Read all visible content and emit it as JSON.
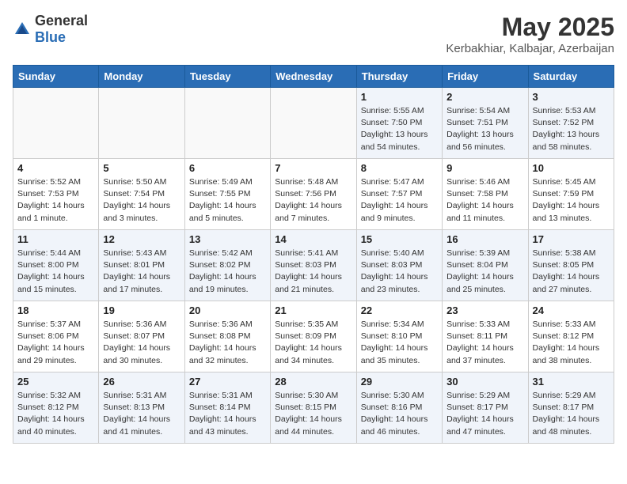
{
  "header": {
    "logo_general": "General",
    "logo_blue": "Blue",
    "month_year": "May 2025",
    "location": "Kerbakhiar, Kalbajar, Azerbaijan"
  },
  "days_of_week": [
    "Sunday",
    "Monday",
    "Tuesday",
    "Wednesday",
    "Thursday",
    "Friday",
    "Saturday"
  ],
  "weeks": [
    [
      {
        "day": "",
        "info": ""
      },
      {
        "day": "",
        "info": ""
      },
      {
        "day": "",
        "info": ""
      },
      {
        "day": "",
        "info": ""
      },
      {
        "day": "1",
        "info": "Sunrise: 5:55 AM\nSunset: 7:50 PM\nDaylight: 13 hours\nand 54 minutes."
      },
      {
        "day": "2",
        "info": "Sunrise: 5:54 AM\nSunset: 7:51 PM\nDaylight: 13 hours\nand 56 minutes."
      },
      {
        "day": "3",
        "info": "Sunrise: 5:53 AM\nSunset: 7:52 PM\nDaylight: 13 hours\nand 58 minutes."
      }
    ],
    [
      {
        "day": "4",
        "info": "Sunrise: 5:52 AM\nSunset: 7:53 PM\nDaylight: 14 hours\nand 1 minute."
      },
      {
        "day": "5",
        "info": "Sunrise: 5:50 AM\nSunset: 7:54 PM\nDaylight: 14 hours\nand 3 minutes."
      },
      {
        "day": "6",
        "info": "Sunrise: 5:49 AM\nSunset: 7:55 PM\nDaylight: 14 hours\nand 5 minutes."
      },
      {
        "day": "7",
        "info": "Sunrise: 5:48 AM\nSunset: 7:56 PM\nDaylight: 14 hours\nand 7 minutes."
      },
      {
        "day": "8",
        "info": "Sunrise: 5:47 AM\nSunset: 7:57 PM\nDaylight: 14 hours\nand 9 minutes."
      },
      {
        "day": "9",
        "info": "Sunrise: 5:46 AM\nSunset: 7:58 PM\nDaylight: 14 hours\nand 11 minutes."
      },
      {
        "day": "10",
        "info": "Sunrise: 5:45 AM\nSunset: 7:59 PM\nDaylight: 14 hours\nand 13 minutes."
      }
    ],
    [
      {
        "day": "11",
        "info": "Sunrise: 5:44 AM\nSunset: 8:00 PM\nDaylight: 14 hours\nand 15 minutes."
      },
      {
        "day": "12",
        "info": "Sunrise: 5:43 AM\nSunset: 8:01 PM\nDaylight: 14 hours\nand 17 minutes."
      },
      {
        "day": "13",
        "info": "Sunrise: 5:42 AM\nSunset: 8:02 PM\nDaylight: 14 hours\nand 19 minutes."
      },
      {
        "day": "14",
        "info": "Sunrise: 5:41 AM\nSunset: 8:03 PM\nDaylight: 14 hours\nand 21 minutes."
      },
      {
        "day": "15",
        "info": "Sunrise: 5:40 AM\nSunset: 8:03 PM\nDaylight: 14 hours\nand 23 minutes."
      },
      {
        "day": "16",
        "info": "Sunrise: 5:39 AM\nSunset: 8:04 PM\nDaylight: 14 hours\nand 25 minutes."
      },
      {
        "day": "17",
        "info": "Sunrise: 5:38 AM\nSunset: 8:05 PM\nDaylight: 14 hours\nand 27 minutes."
      }
    ],
    [
      {
        "day": "18",
        "info": "Sunrise: 5:37 AM\nSunset: 8:06 PM\nDaylight: 14 hours\nand 29 minutes."
      },
      {
        "day": "19",
        "info": "Sunrise: 5:36 AM\nSunset: 8:07 PM\nDaylight: 14 hours\nand 30 minutes."
      },
      {
        "day": "20",
        "info": "Sunrise: 5:36 AM\nSunset: 8:08 PM\nDaylight: 14 hours\nand 32 minutes."
      },
      {
        "day": "21",
        "info": "Sunrise: 5:35 AM\nSunset: 8:09 PM\nDaylight: 14 hours\nand 34 minutes."
      },
      {
        "day": "22",
        "info": "Sunrise: 5:34 AM\nSunset: 8:10 PM\nDaylight: 14 hours\nand 35 minutes."
      },
      {
        "day": "23",
        "info": "Sunrise: 5:33 AM\nSunset: 8:11 PM\nDaylight: 14 hours\nand 37 minutes."
      },
      {
        "day": "24",
        "info": "Sunrise: 5:33 AM\nSunset: 8:12 PM\nDaylight: 14 hours\nand 38 minutes."
      }
    ],
    [
      {
        "day": "25",
        "info": "Sunrise: 5:32 AM\nSunset: 8:12 PM\nDaylight: 14 hours\nand 40 minutes."
      },
      {
        "day": "26",
        "info": "Sunrise: 5:31 AM\nSunset: 8:13 PM\nDaylight: 14 hours\nand 41 minutes."
      },
      {
        "day": "27",
        "info": "Sunrise: 5:31 AM\nSunset: 8:14 PM\nDaylight: 14 hours\nand 43 minutes."
      },
      {
        "day": "28",
        "info": "Sunrise: 5:30 AM\nSunset: 8:15 PM\nDaylight: 14 hours\nand 44 minutes."
      },
      {
        "day": "29",
        "info": "Sunrise: 5:30 AM\nSunset: 8:16 PM\nDaylight: 14 hours\nand 46 minutes."
      },
      {
        "day": "30",
        "info": "Sunrise: 5:29 AM\nSunset: 8:17 PM\nDaylight: 14 hours\nand 47 minutes."
      },
      {
        "day": "31",
        "info": "Sunrise: 5:29 AM\nSunset: 8:17 PM\nDaylight: 14 hours\nand 48 minutes."
      }
    ]
  ]
}
